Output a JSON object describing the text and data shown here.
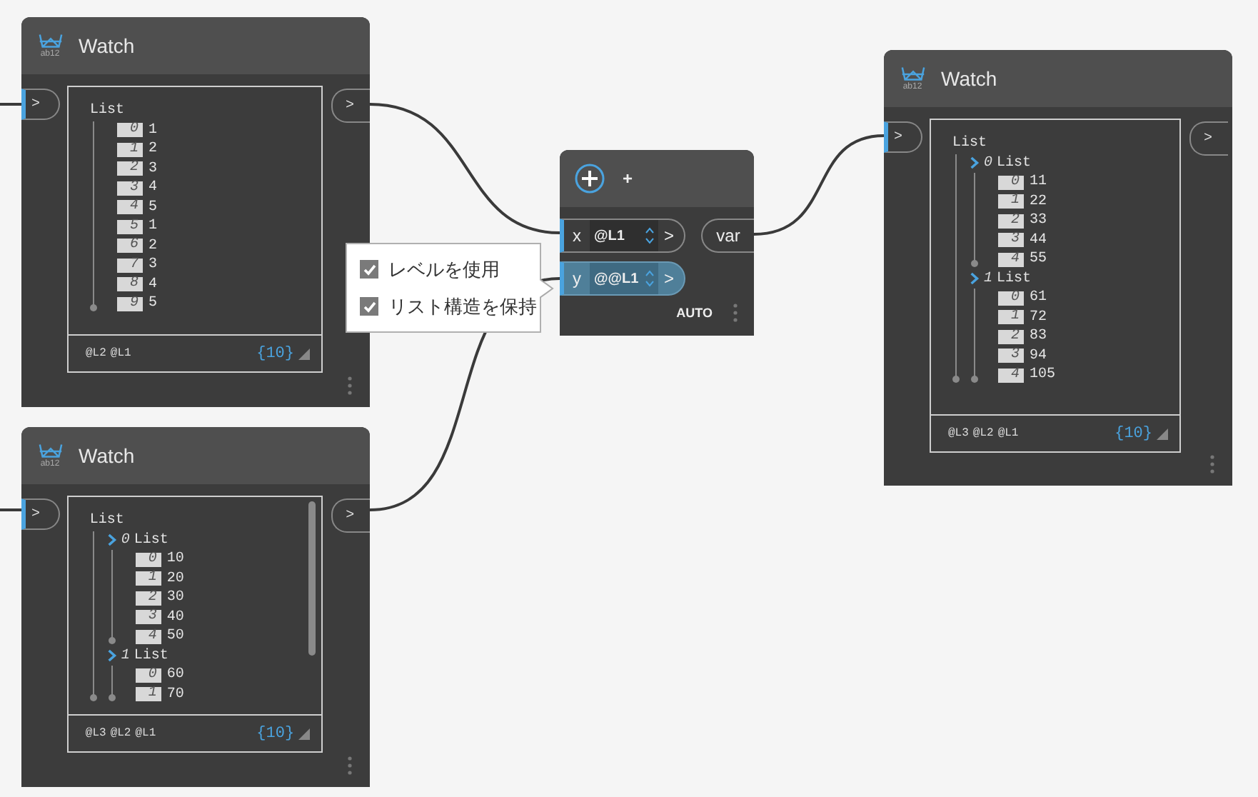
{
  "watch_nodes": [
    {
      "title": "Watch",
      "icon_caption": "ab12",
      "input_port": ">",
      "output_port": ">",
      "scrollbar": false,
      "tree": {
        "kind": "list",
        "label": "List",
        "children": [
          {
            "kind": "item",
            "index": "0",
            "value": "1"
          },
          {
            "kind": "item",
            "index": "1",
            "value": "2"
          },
          {
            "kind": "item",
            "index": "2",
            "value": "3"
          },
          {
            "kind": "item",
            "index": "3",
            "value": "4"
          },
          {
            "kind": "item",
            "index": "4",
            "value": "5"
          },
          {
            "kind": "item",
            "index": "5",
            "value": "1"
          },
          {
            "kind": "item",
            "index": "6",
            "value": "2"
          },
          {
            "kind": "item",
            "index": "7",
            "value": "3"
          },
          {
            "kind": "item",
            "index": "8",
            "value": "4"
          },
          {
            "kind": "item",
            "index": "9",
            "value": "5"
          }
        ]
      },
      "levels": [
        "@L2",
        "@L1"
      ],
      "count": "{10}"
    },
    {
      "title": "Watch",
      "icon_caption": "ab12",
      "input_port": ">",
      "output_port": ">",
      "scrollbar": true,
      "tree": {
        "kind": "list",
        "label": "List",
        "children": [
          {
            "kind": "list",
            "index": "0",
            "label": "List",
            "children": [
              {
                "kind": "item",
                "index": "0",
                "value": "10"
              },
              {
                "kind": "item",
                "index": "1",
                "value": "20"
              },
              {
                "kind": "item",
                "index": "2",
                "value": "30"
              },
              {
                "kind": "item",
                "index": "3",
                "value": "40"
              },
              {
                "kind": "item",
                "index": "4",
                "value": "50"
              }
            ]
          },
          {
            "kind": "list",
            "index": "1",
            "label": "List",
            "children": [
              {
                "kind": "item",
                "index": "0",
                "value": "60"
              },
              {
                "kind": "item",
                "index": "1",
                "value": "70"
              }
            ]
          }
        ]
      },
      "levels": [
        "@L3",
        "@L2",
        "@L1"
      ],
      "count": "{10}"
    },
    {
      "title": "Watch",
      "icon_caption": "ab12",
      "input_port": ">",
      "output_port": ">",
      "scrollbar": false,
      "tree": {
        "kind": "list",
        "label": "List",
        "children": [
          {
            "kind": "list",
            "index": "0",
            "label": "List",
            "children": [
              {
                "kind": "item",
                "index": "0",
                "value": "11"
              },
              {
                "kind": "item",
                "index": "1",
                "value": "22"
              },
              {
                "kind": "item",
                "index": "2",
                "value": "33"
              },
              {
                "kind": "item",
                "index": "3",
                "value": "44"
              },
              {
                "kind": "item",
                "index": "4",
                "value": "55"
              }
            ]
          },
          {
            "kind": "list",
            "index": "1",
            "label": "List",
            "children": [
              {
                "kind": "item",
                "index": "0",
                "value": "61"
              },
              {
                "kind": "item",
                "index": "1",
                "value": "72"
              },
              {
                "kind": "item",
                "index": "2",
                "value": "83"
              },
              {
                "kind": "item",
                "index": "3",
                "value": "94"
              },
              {
                "kind": "item",
                "index": "4",
                "value": "105"
              }
            ]
          }
        ]
      },
      "levels": [
        "@L3",
        "@L2",
        "@L1"
      ],
      "count": "{10}"
    }
  ],
  "code_block": {
    "title": "+",
    "inputs": [
      {
        "name": "x",
        "level": "@L1",
        "port": ">",
        "selected": false
      },
      {
        "name": "y",
        "level": "@@L1",
        "port": ">",
        "selected": true
      }
    ],
    "output": "var",
    "lacing": "AUTO"
  },
  "lacing_menu": {
    "options": [
      {
        "label": "レベルを使用",
        "checked": true
      },
      {
        "label": "リスト構造を保持",
        "checked": true
      }
    ]
  }
}
